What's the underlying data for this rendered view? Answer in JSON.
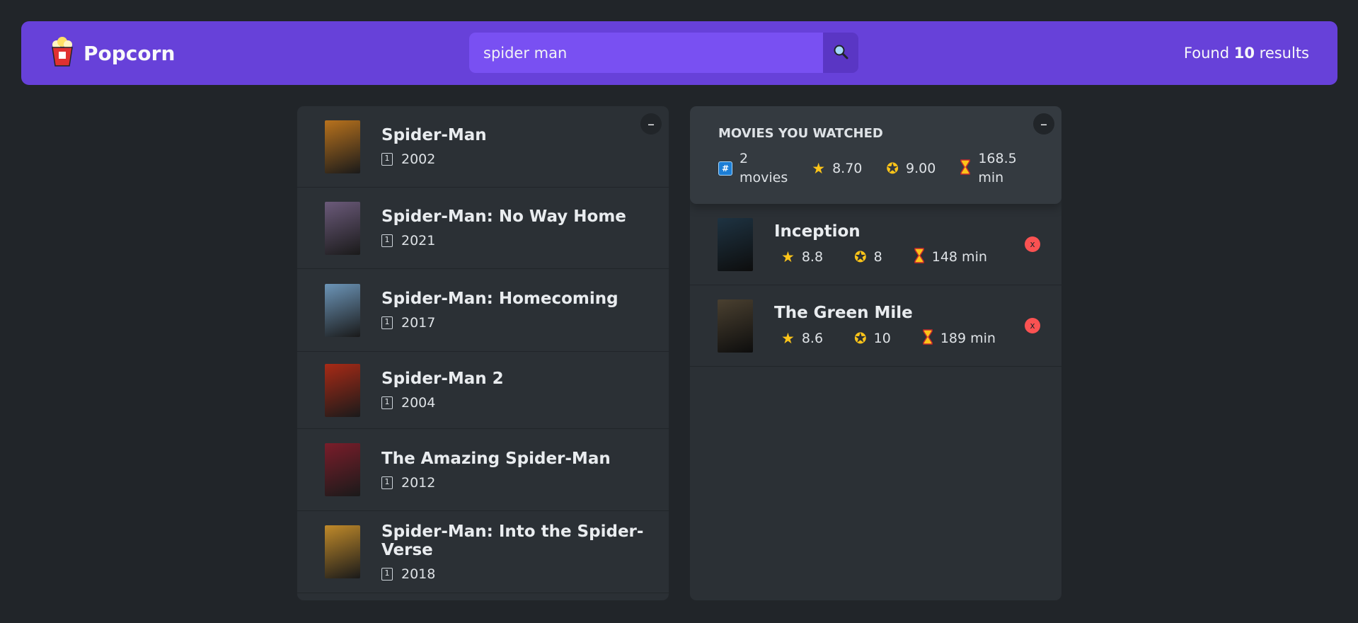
{
  "app": {
    "name": "Popcorn"
  },
  "search": {
    "value": "spider man"
  },
  "results": {
    "prefix": "Found",
    "count": "10",
    "suffix": "results"
  },
  "colors": {
    "primary": "#6741d9",
    "primary_light": "#7950f2",
    "background": "#212529",
    "box": "#2b3035",
    "delete": "#fa5252"
  },
  "movies": [
    {
      "title": "Spider-Man",
      "year": "2002",
      "poster_color": "#b8721d"
    },
    {
      "title": "Spider-Man: No Way Home",
      "year": "2021",
      "poster_color": "#6b5a7a"
    },
    {
      "title": "Spider-Man: Homecoming",
      "year": "2017",
      "poster_color": "#6c95b8"
    },
    {
      "title": "Spider-Man 2",
      "year": "2004",
      "poster_color": "#a82a16"
    },
    {
      "title": "The Amazing Spider-Man",
      "year": "2012",
      "poster_color": "#7a1d2a"
    },
    {
      "title": "Spider-Man: Into the Spider-Verse",
      "year": "2018",
      "poster_color": "#c08a2a"
    }
  ],
  "summary": {
    "heading": "MOVIES YOU WATCHED",
    "count_num": "2",
    "count_label": "movies",
    "avg_imdb": "8.70",
    "avg_user": "9.00",
    "avg_runtime_num": "168.5",
    "avg_runtime_unit": "min"
  },
  "watched": [
    {
      "title": "Inception",
      "imdb": "8.8",
      "user": "8",
      "runtime": "148 min",
      "poster_color": "#1e3342"
    },
    {
      "title": "The Green Mile",
      "imdb": "8.6",
      "user": "10",
      "runtime": "189 min",
      "poster_color": "#4a4030"
    }
  ],
  "labels": {
    "toggle": "–",
    "delete": "x",
    "hash": "#"
  },
  "icons": {
    "logo": "popcorn-icon",
    "search": "magnifier-icon",
    "year": "calendar-icon",
    "imdb": "star-icon",
    "user_rating": "glowing-star-icon",
    "runtime": "hourglass-icon"
  }
}
